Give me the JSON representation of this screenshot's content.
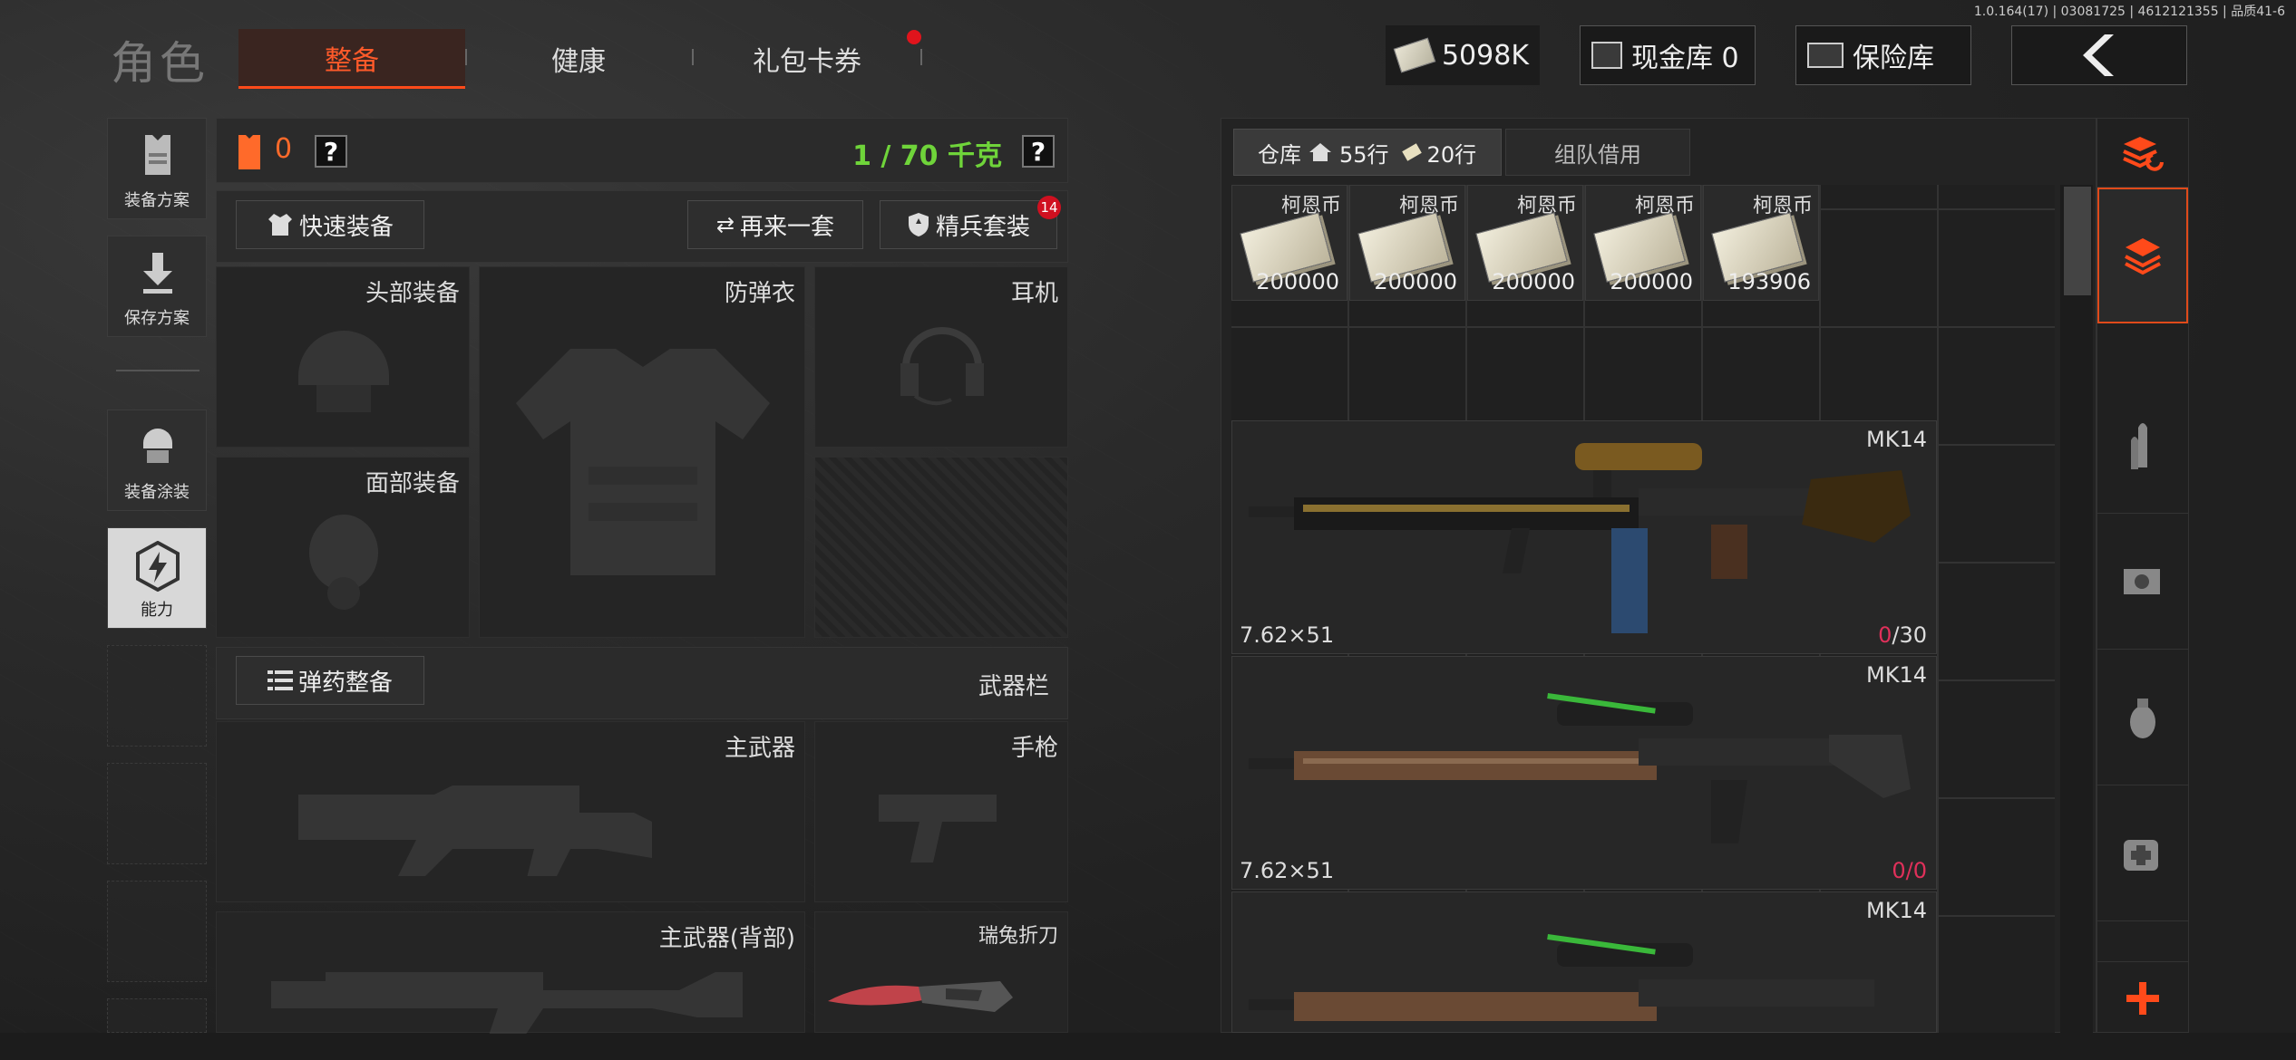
{
  "version": "1.0.164(17) | 03081725 | 4612121355 | 品质41-6",
  "title": "角色",
  "tabs": [
    {
      "label": "整备",
      "active": true
    },
    {
      "label": "健康",
      "active": false
    },
    {
      "label": "礼包卡券",
      "active": false
    }
  ],
  "currency": {
    "cash": "5098K",
    "cash_vault": "现金库 0",
    "insurance": "保险库"
  },
  "sidebar": {
    "items": [
      {
        "label": "装备方案",
        "icon": "vest-icon"
      },
      {
        "label": "保存方案",
        "icon": "download-icon"
      },
      {
        "label": "装备涂装",
        "icon": "helmet-spray-icon"
      },
      {
        "label": "能力",
        "icon": "ability-icon"
      }
    ]
  },
  "loadout": {
    "armor_count": "0",
    "weight": "1 / 70 千克",
    "quick_equip": "快速装备",
    "again": "再来一套",
    "elite": "精兵套装",
    "elite_badge": "14",
    "slots": {
      "head": "头部装备",
      "vest": "防弹衣",
      "earphone": "耳机",
      "face": "面部装备"
    },
    "ammo_btn": "弹药整备",
    "weapon_bar": "武器栏",
    "weapons": {
      "primary": "主武器",
      "pistol": "手枪",
      "primary_back": "主武器(背部)",
      "knife": "瑞兔折刀"
    }
  },
  "warehouse": {
    "tab": "仓库",
    "rows_home": "55行",
    "rows_cash": "20行",
    "team_borrow": "组队借用",
    "cash_items": [
      {
        "name": "柯恩币",
        "amount": "200000"
      },
      {
        "name": "柯恩币",
        "amount": "200000"
      },
      {
        "name": "柯恩币",
        "amount": "200000"
      },
      {
        "name": "柯恩币",
        "amount": "200000"
      },
      {
        "name": "柯恩币",
        "amount": "193906"
      }
    ],
    "weapons": [
      {
        "name": "MK14",
        "caliber": "7.62×51",
        "ammo_cur": "0",
        "ammo_max": "30"
      },
      {
        "name": "MK14",
        "caliber": "7.62×51",
        "ammo_cur": "0",
        "ammo_max": "0"
      },
      {
        "name": "MK14",
        "caliber": "",
        "ammo_cur": "",
        "ammo_max": ""
      }
    ]
  },
  "colors": {
    "accent": "#ff4a1a",
    "weight_green": "#6fd43a",
    "ammo_red": "#e0305a"
  }
}
